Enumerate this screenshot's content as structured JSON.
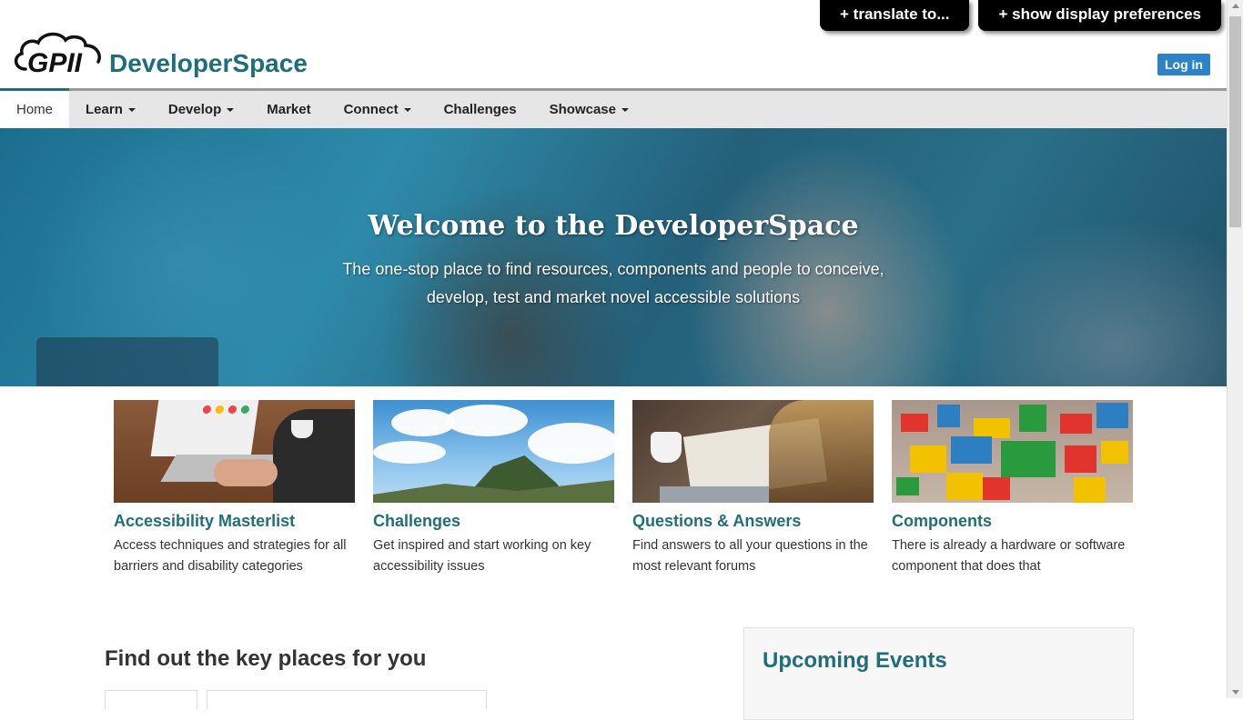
{
  "toggles": {
    "translate": "+ translate to...",
    "display_prefs": "+ show display preferences"
  },
  "header": {
    "logo_text": "GPII",
    "brand": "DeveloperSpace",
    "login": "Log in"
  },
  "nav": {
    "items": [
      {
        "label": "Home",
        "dropdown": false
      },
      {
        "label": "Learn",
        "dropdown": true
      },
      {
        "label": "Develop",
        "dropdown": true
      },
      {
        "label": "Market",
        "dropdown": false
      },
      {
        "label": "Connect",
        "dropdown": true
      },
      {
        "label": "Challenges",
        "dropdown": false
      },
      {
        "label": "Showcase",
        "dropdown": true
      }
    ]
  },
  "hero": {
    "title": "Welcome to the DeveloperSpace",
    "subtitle": "The one-stop place to find resources, components and people to conceive, develop, test and market novel accessible solutions"
  },
  "cards": [
    {
      "title": "Accessibility Masterlist",
      "desc": "Access techniques and strategies for all barriers and disability categories"
    },
    {
      "title": "Challenges",
      "desc": "Get inspired and start working on key accessibility issues"
    },
    {
      "title": "Questions & Answers",
      "desc": "Find answers to all your questions in the most relevant forums"
    },
    {
      "title": "Components",
      "desc": "There is already a hardware or software component that does that"
    }
  ],
  "sections": {
    "find_title": "Find out the key places for you",
    "events_title": "Upcoming Events"
  },
  "colors": {
    "brand_teal": "#1f6e7a",
    "login_blue": "#2d83c5",
    "toggle_black": "#000000"
  }
}
